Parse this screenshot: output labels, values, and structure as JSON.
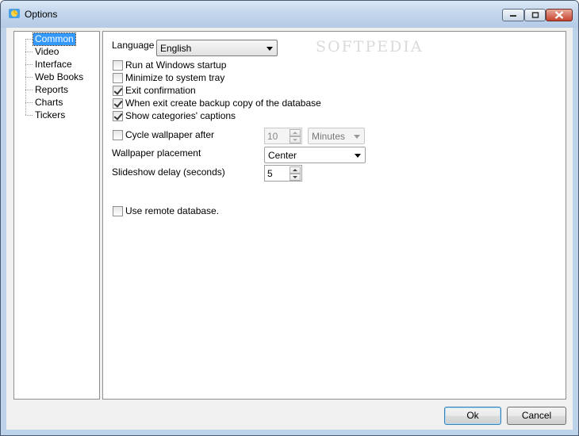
{
  "window": {
    "title": "Options"
  },
  "tree": {
    "items": [
      {
        "label": "Common",
        "selected": true
      },
      {
        "label": "Video"
      },
      {
        "label": "Interface"
      },
      {
        "label": "Web Books"
      },
      {
        "label": "Reports"
      },
      {
        "label": "Charts"
      },
      {
        "label": "Tickers"
      }
    ]
  },
  "common": {
    "language_label": "Language",
    "language_value": "English",
    "watermark": "SOFTPEDIA",
    "checks": {
      "run_startup": {
        "label": "Run at Windows startup",
        "checked": false
      },
      "minimize_tray": {
        "label": "Minimize to system tray",
        "checked": false
      },
      "exit_confirm": {
        "label": "Exit confirmation",
        "checked": true
      },
      "backup_copy": {
        "label": "When exit create backup copy of the database",
        "checked": true
      },
      "show_captions": {
        "label": "Show categories' captions",
        "checked": true
      },
      "cycle_wallpaper": {
        "label": "Cycle wallpaper after",
        "checked": false
      },
      "remote_db": {
        "label": "Use remote database.",
        "checked": false
      }
    },
    "cycle_value": "10",
    "cycle_unit": "Minutes",
    "placement_label": "Wallpaper placement",
    "placement_value": "Center",
    "slideshow_label": "Slideshow delay (seconds)",
    "slideshow_value": "5"
  },
  "buttons": {
    "ok": "Ok",
    "cancel": "Cancel"
  }
}
